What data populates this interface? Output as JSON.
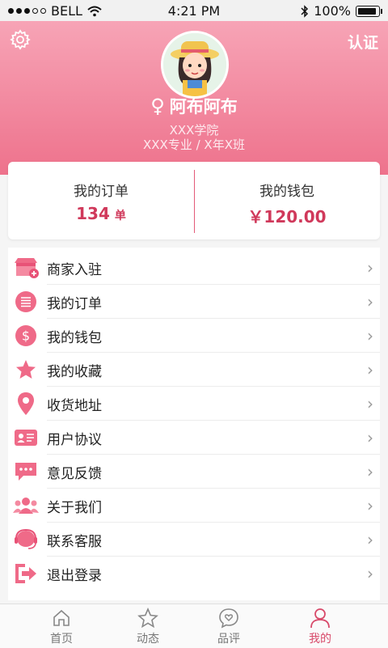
{
  "status_bar": {
    "carrier": "BELL",
    "time": "4:21 PM",
    "battery": "100%"
  },
  "header": {
    "certify_label": "认证",
    "gender_symbol": "♀",
    "username": "阿布阿布",
    "school": "XXX学院",
    "major": "XXX专业 / X年X班"
  },
  "summary": {
    "orders_title": "我的订单",
    "orders_value": "134",
    "orders_unit": "单",
    "wallet_title": "我的钱包",
    "wallet_value": "￥120.00"
  },
  "menu": [
    {
      "label": "商家入驻",
      "icon": "store-icon"
    },
    {
      "label": "我的订单",
      "icon": "list-icon"
    },
    {
      "label": "我的钱包",
      "icon": "dollar-icon"
    },
    {
      "label": "我的收藏",
      "icon": "star-icon"
    },
    {
      "label": "收货地址",
      "icon": "location-pin-icon"
    },
    {
      "label": "用户协议",
      "icon": "id-card-icon"
    },
    {
      "label": "意见反馈",
      "icon": "chat-bubble-icon"
    },
    {
      "label": "关于我们",
      "icon": "people-icon"
    },
    {
      "label": "联系客服",
      "icon": "headset-icon"
    },
    {
      "label": "退出登录",
      "icon": "logout-icon"
    }
  ],
  "chevron": "›",
  "tabs": [
    {
      "label": "首页",
      "icon": "home-icon",
      "active": false
    },
    {
      "label": "动态",
      "icon": "star-outline-icon",
      "active": false
    },
    {
      "label": "品评",
      "icon": "heart-chat-icon",
      "active": false
    },
    {
      "label": "我的",
      "icon": "user-icon",
      "active": true
    }
  ],
  "colors": {
    "accent": "#d84a6a",
    "header_top": "#f7a4b6",
    "header_bottom": "#ee728c",
    "icon_pink": "#ef6a88"
  }
}
